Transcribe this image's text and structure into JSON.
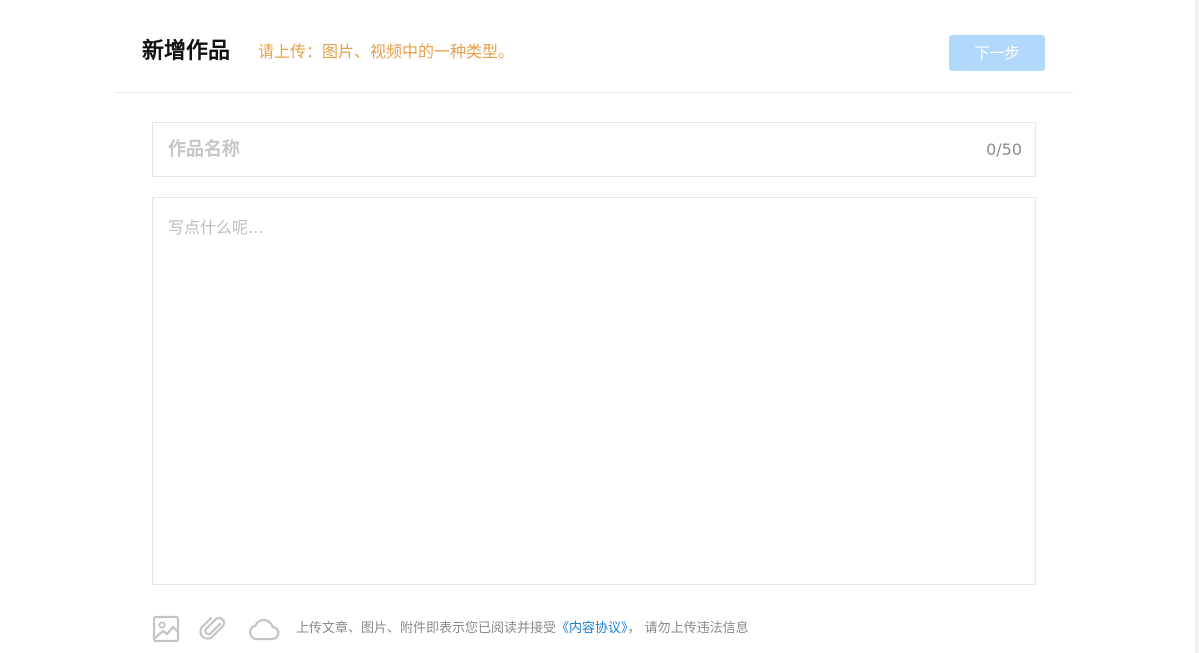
{
  "header": {
    "title": "新增作品",
    "hint": "请上传：图片、视频中的一种类型。",
    "next_label": "下一步"
  },
  "form": {
    "title_placeholder": "作品名称",
    "title_value": "",
    "title_counter": "0/50",
    "content_placeholder": "写点什么呢...",
    "content_value": ""
  },
  "toolbar": {
    "icons": [
      "image-icon",
      "paperclip-icon",
      "cloud-icon"
    ],
    "agreement_prefix": "上传文章、图片、附件即表示您已阅读并接受",
    "agreement_link": "《内容协议》",
    "agreement_suffix": "，  请勿上传违法信息"
  },
  "colors": {
    "hint": "#e8a04a",
    "next_button_disabled": "#b2d9fb",
    "link": "#1a7fd4",
    "border": "#e6e6e6"
  }
}
